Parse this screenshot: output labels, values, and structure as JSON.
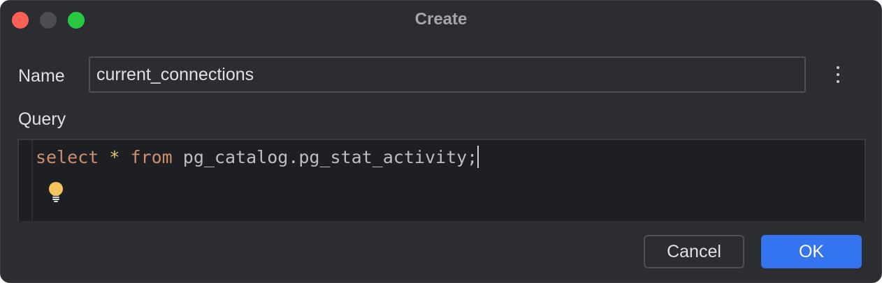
{
  "window": {
    "title": "Create",
    "controls": {
      "close_color": "#fe5f57",
      "minimize_color": "#4b4d51",
      "zoom_color": "#28c840"
    }
  },
  "form": {
    "name_label": "Name",
    "name_value": "current_connections",
    "query_label": "Query",
    "more_icon": "vertical-ellipsis-icon"
  },
  "editor": {
    "tokens": {
      "keyword_select": "select",
      "star": "*",
      "keyword_from": "from",
      "identifier": "pg_catalog.pg_stat_activity;"
    },
    "intention_icon": "lightbulb-icon"
  },
  "buttons": {
    "cancel_label": "Cancel",
    "ok_label": "OK",
    "accent_color": "#3574f0"
  }
}
